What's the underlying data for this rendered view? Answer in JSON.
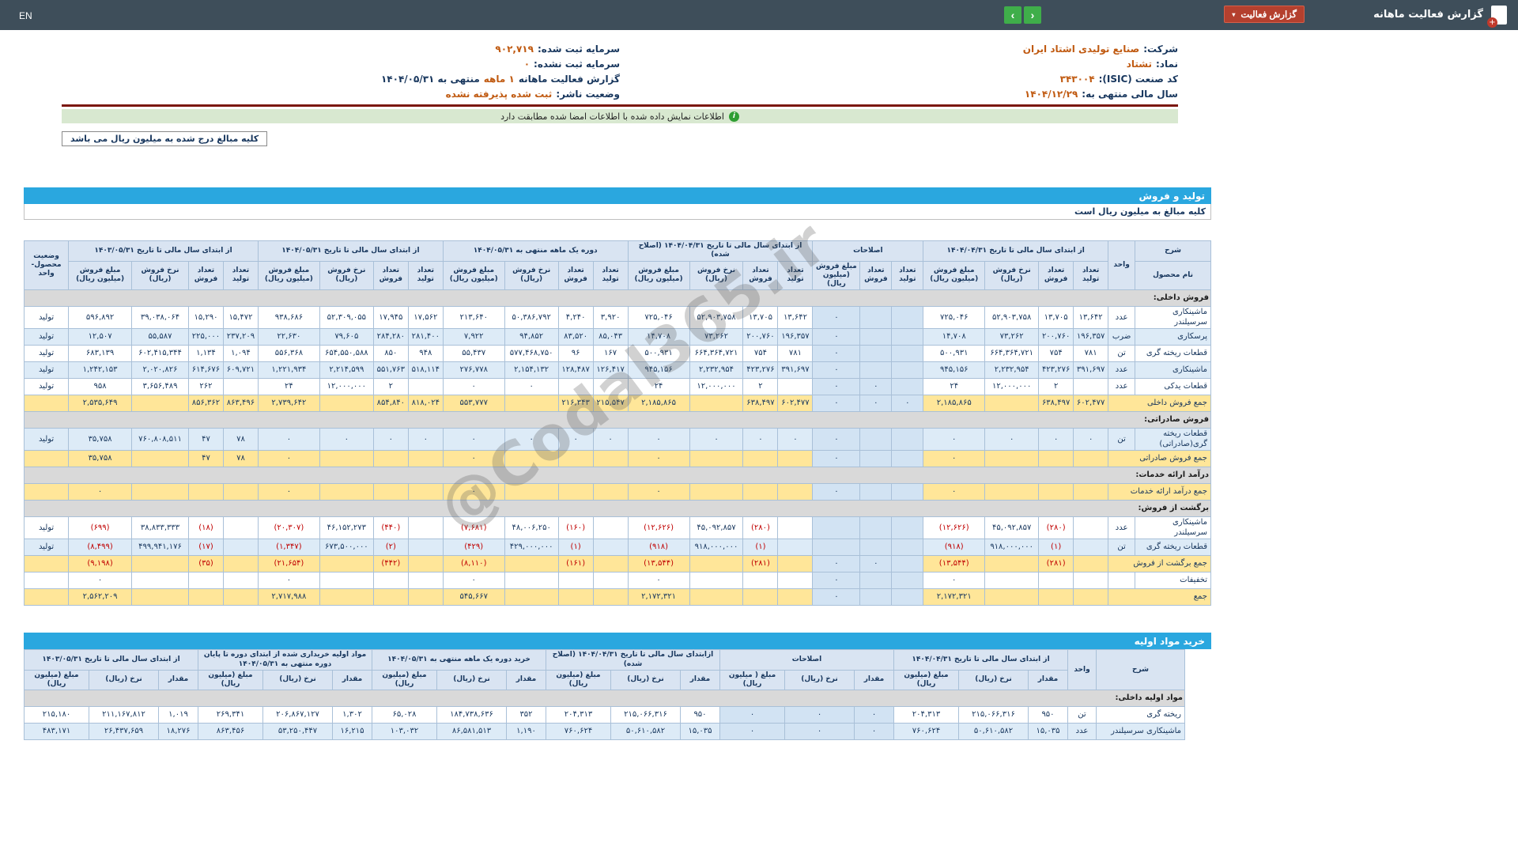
{
  "colors": {
    "topbar": "#3E4E5A",
    "accent_blue": "#2AA7DF",
    "green_button": "#3FAE4A",
    "chip_red": "#B4402E",
    "value_orange": "#C05A11",
    "negative_red": "#C00000",
    "sum_yellow": "#FFE699",
    "section_gray": "#D9D9D9",
    "signed_green": "#D8E8D0",
    "divider_red": "#7B170E"
  },
  "icons": {
    "caret_down": "▾",
    "prev_arrow": "‹",
    "next_arrow": "›",
    "info": "i",
    "plus": "+"
  },
  "watermark": "@Codal365.ir",
  "header": {
    "en_label": "EN",
    "title": "گزارش فعالیت ماهانه",
    "badge_label": "گزارش فعالیت"
  },
  "info": {
    "right_rows": [
      {
        "label": "شرکت:",
        "value": "صنایع تولیدی اشتاد ایران",
        "suffix": ""
      },
      {
        "label": "نماد:",
        "value": "تشتاد",
        "suffix": ""
      },
      {
        "label": "کد صنعت (ISIC):",
        "value": "۳۴۳۰۰۴",
        "suffix": ""
      },
      {
        "label": "سال مالی منتهی به:",
        "value": "۱۴۰۴/۱۲/۲۹",
        "suffix": ""
      }
    ],
    "left_rows": [
      {
        "label": "سرمایه ثبت شده:",
        "value": "۹۰۲,۷۱۹",
        "suffix": ""
      },
      {
        "label": "سرمایه ثبت نشده:",
        "value": "۰",
        "suffix": ""
      },
      {
        "label": "گزارش فعالیت ماهانه",
        "value": "۱ ماهه",
        "suffix": "منتهی به ۱۴۰۴/۰۵/۳۱"
      },
      {
        "label": "وضعیت ناشر:",
        "value": "ثبت شده پذیرفته نشده",
        "suffix": ""
      }
    ],
    "signed_note": "اطلاعات نمایش داده شده با اطلاعات امضا شده مطابقت دارد",
    "amounts_note": "کلیه مبالغ درج شده به میلیون ریال می باشد"
  },
  "production_sales": {
    "bar_title": "تولید و فروش",
    "note_row": "کلیه مبالغ به میلیون ریال است",
    "head": {
      "sharh": "شرح",
      "product": "نام محصول",
      "unit": "واحد",
      "status": "وضعیت محصول-واحد"
    },
    "groups": [
      {
        "label": "از ابتدای سال مالی تا تاریخ ۱۴۰۴/۰۴/۳۱",
        "cols": [
          "تعداد تولید",
          "تعداد فروش",
          "نرخ فروش (ریال)",
          "مبلغ فروش (میلیون ریال)"
        ]
      },
      {
        "label": "اصلاحات",
        "cols": [
          "تعداد تولید",
          "تعداد فروش",
          "مبلغ فروش (میلیون ریال)"
        ]
      },
      {
        "label": "از ابتدای سال مالی تا تاریخ ۱۴۰۴/۰۴/۳۱ (اصلاح شده)",
        "cols": [
          "تعداد تولید",
          "تعداد فروش",
          "نرخ فروش (ریال)",
          "مبلغ فروش (میلیون ریال)"
        ]
      },
      {
        "label": "دوره یک ماهه منتهی به ۱۴۰۴/۰۵/۳۱",
        "cols": [
          "تعداد تولید",
          "تعداد فروش",
          "نرخ فروش (ریال)",
          "مبلغ فروش (میلیون ریال)"
        ]
      },
      {
        "label": "از ابتدای سال مالی تا تاریخ ۱۴۰۴/۰۵/۳۱",
        "cols": [
          "تعداد تولید",
          "تعداد فروش",
          "نرخ فروش (ریال)",
          "مبلغ فروش (میلیون ریال)"
        ]
      },
      {
        "label": "از ابتدای سال مالی تا تاریخ ۱۴۰۳/۰۵/۳۱",
        "cols": [
          "تعداد تولید",
          "تعداد فروش",
          "نرخ فروش (ریال)",
          "مبلغ فروش (میلیون ریال)"
        ]
      }
    ],
    "rows": [
      {
        "type": "section",
        "label": "فروش داخلی:"
      },
      {
        "type": "data",
        "name": "ماشینکاری سرسیلندر",
        "unit": "عدد",
        "status": "تولید",
        "cells": [
          "۱۳,۶۴۲",
          "۱۳,۷۰۵",
          "۵۲,۹۰۳,۷۵۸",
          "۷۲۵,۰۴۶",
          "",
          "",
          "۰",
          "۱۳,۶۴۲",
          "۱۳,۷۰۵",
          "۵۲,۹۰۳,۷۵۸",
          "۷۲۵,۰۴۶",
          "۳,۹۲۰",
          "۴,۲۴۰",
          "۵۰,۳۸۶,۷۹۲",
          "۲۱۳,۶۴۰",
          "۱۷,۵۶۲",
          "۱۷,۹۴۵",
          "۵۲,۳۰۹,۰۵۵",
          "۹۳۸,۶۸۶",
          "۱۵,۴۷۲",
          "۱۵,۲۹۰",
          "۳۹,۰۳۸,۰۶۴",
          "۵۹۶,۸۹۲"
        ]
      },
      {
        "type": "data",
        "name": "پرسکاری",
        "unit": "ضرب",
        "status": "تولید",
        "cells": [
          "۱۹۶,۳۵۷",
          "۲۰۰,۷۶۰",
          "۷۳,۲۶۲",
          "۱۴,۷۰۸",
          "",
          "",
          "۰",
          "۱۹۶,۳۵۷",
          "۲۰۰,۷۶۰",
          "۷۳,۲۶۲",
          "۱۴,۷۰۸",
          "۸۵,۰۴۳",
          "۸۳,۵۲۰",
          "۹۴,۸۵۲",
          "۷,۹۲۲",
          "۲۸۱,۴۰۰",
          "۲۸۴,۲۸۰",
          "۷۹,۶۰۵",
          "۲۲,۶۳۰",
          "۲۳۷,۲۰۹",
          "۲۲۵,۰۰۰",
          "۵۵,۵۸۷",
          "۱۲,۵۰۷"
        ]
      },
      {
        "type": "data",
        "name": "قطعات ریخته گری",
        "unit": "تن",
        "status": "تولید",
        "cells": [
          "۷۸۱",
          "۷۵۴",
          "۶۶۴,۳۶۴,۷۲۱",
          "۵۰۰,۹۳۱",
          "",
          "",
          "۰",
          "۷۸۱",
          "۷۵۴",
          "۶۶۴,۳۶۴,۷۲۱",
          "۵۰۰,۹۳۱",
          "۱۶۷",
          "۹۶",
          "۵۷۷,۴۶۸,۷۵۰",
          "۵۵,۴۳۷",
          "۹۴۸",
          "۸۵۰",
          "۶۵۴,۵۵۰,۵۸۸",
          "۵۵۶,۳۶۸",
          "۱,۰۹۴",
          "۱,۱۳۴",
          "۶۰۲,۴۱۵,۳۴۴",
          "۶۸۳,۱۳۹"
        ]
      },
      {
        "type": "data",
        "name": "ماشینکاری",
        "unit": "عدد",
        "status": "تولید",
        "cells": [
          "۳۹۱,۶۹۷",
          "۴۲۳,۲۷۶",
          "۲,۲۳۲,۹۵۴",
          "۹۴۵,۱۵۶",
          "",
          "",
          "۰",
          "۳۹۱,۶۹۷",
          "۴۲۳,۲۷۶",
          "۲,۲۳۲,۹۵۴",
          "۹۴۵,۱۵۶",
          "۱۲۶,۴۱۷",
          "۱۲۸,۴۸۷",
          "۲,۱۵۴,۱۳۲",
          "۲۷۶,۷۷۸",
          "۵۱۸,۱۱۴",
          "۵۵۱,۷۶۳",
          "۲,۲۱۴,۵۹۹",
          "۱,۲۲۱,۹۳۴",
          "۶۰۹,۷۲۱",
          "۶۱۴,۶۷۶",
          "۲,۰۲۰,۸۲۶",
          "۱,۲۴۲,۱۵۳"
        ]
      },
      {
        "type": "data",
        "name": "قطعات یدکی",
        "unit": "عدد",
        "status": "تولید",
        "cells": [
          "",
          "۲",
          "۱۲,۰۰۰,۰۰۰",
          "۲۴",
          "",
          "۰",
          "۰",
          "",
          "۲",
          "۱۲,۰۰۰,۰۰۰",
          "۲۴",
          "",
          "",
          "۰",
          "۰",
          "",
          "۲",
          "۱۲,۰۰۰,۰۰۰",
          "۲۴",
          "",
          "۲۶۲",
          "۳,۶۵۶,۴۸۹",
          "۹۵۸"
        ]
      },
      {
        "type": "sum",
        "name": "جمع فروش داخلی",
        "status": "",
        "cells": [
          "۶۰۲,۴۷۷",
          "۶۳۸,۴۹۷",
          "",
          "۲,۱۸۵,۸۶۵",
          "۰",
          "۰",
          "۰",
          "۶۰۲,۴۷۷",
          "۶۳۸,۴۹۷",
          "",
          "۲,۱۸۵,۸۶۵",
          "۲۱۵,۵۴۷",
          "۲۱۶,۳۴۳",
          "",
          "۵۵۳,۷۷۷",
          "۸۱۸,۰۲۴",
          "۸۵۴,۸۴۰",
          "",
          "۲,۷۳۹,۶۴۲",
          "۸۶۳,۴۹۶",
          "۸۵۶,۳۶۲",
          "",
          "۲,۵۳۵,۶۴۹"
        ]
      },
      {
        "type": "section",
        "label": "فروش صادراتی:"
      },
      {
        "type": "data",
        "name": "قطعات ریخته گری(صادراتی)",
        "unit": "تن",
        "status": "تولید",
        "cells": [
          "۰",
          "۰",
          "۰",
          "۰",
          "",
          "",
          "۰",
          "۰",
          "۰",
          "۰",
          "۰",
          "۰",
          "۰",
          "۰",
          "۰",
          "۰",
          "۰",
          "۰",
          "۰",
          "۷۸",
          "۴۷",
          "۷۶۰,۸۰۸,۵۱۱",
          "۳۵,۷۵۸"
        ]
      },
      {
        "type": "sum",
        "name": "جمع فروش صادراتی",
        "status": "",
        "cells": [
          "",
          "",
          "",
          "۰",
          "",
          "",
          "۰",
          "",
          "",
          "",
          "۰",
          "",
          "",
          "",
          "۰",
          "",
          "",
          "",
          "۰",
          "۷۸",
          "۴۷",
          "",
          "۳۵,۷۵۸"
        ]
      },
      {
        "type": "section",
        "label": "درآمد ارائه خدمات:"
      },
      {
        "type": "sum",
        "name": "جمع درآمد ارائه خدمات",
        "status": "",
        "cells": [
          "",
          "",
          "",
          "۰",
          "",
          "",
          "۰",
          "",
          "",
          "",
          "۰",
          "",
          "",
          "",
          "۰",
          "",
          "",
          "",
          "۰",
          "",
          "",
          "",
          "۰"
        ]
      },
      {
        "type": "section",
        "label": "برگشت از فروش:"
      },
      {
        "type": "data",
        "name": "ماشینکاری سرسیلندر",
        "unit": "عدد",
        "status": "تولید",
        "cells": [
          "",
          "(۲۸۰)",
          "۴۵,۰۹۲,۸۵۷",
          "(۱۲,۶۲۶)",
          "",
          "",
          "",
          "",
          "(۲۸۰)",
          "۴۵,۰۹۲,۸۵۷",
          "(۱۲,۶۲۶)",
          "",
          "(۱۶۰)",
          "۴۸,۰۰۶,۲۵۰",
          "(۷,۶۸۱)",
          "",
          "(۴۴۰)",
          "۴۶,۱۵۲,۲۷۳",
          "(۲۰,۳۰۷)",
          "",
          "(۱۸)",
          "۳۸,۸۳۳,۳۳۳",
          "(۶۹۹)"
        ]
      },
      {
        "type": "data",
        "name": "قطعات ریخته گری",
        "unit": "تن",
        "status": "تولید",
        "cells": [
          "",
          "(۱)",
          "۹۱۸,۰۰۰,۰۰۰",
          "(۹۱۸)",
          "",
          "",
          "",
          "",
          "(۱)",
          "۹۱۸,۰۰۰,۰۰۰",
          "(۹۱۸)",
          "",
          "(۱)",
          "۴۲۹,۰۰۰,۰۰۰",
          "(۴۲۹)",
          "",
          "(۲)",
          "۶۷۳,۵۰۰,۰۰۰",
          "(۱,۳۴۷)",
          "",
          "(۱۷)",
          "۴۹۹,۹۴۱,۱۷۶",
          "(۸,۴۹۹)"
        ]
      },
      {
        "type": "sum",
        "name": "جمع برگشت از فروش",
        "status": "",
        "cells": [
          "",
          "(۲۸۱)",
          "",
          "(۱۳,۵۴۴)",
          "",
          "۰",
          "۰",
          "",
          "(۲۸۱)",
          "",
          "(۱۳,۵۴۴)",
          "",
          "(۱۶۱)",
          "",
          "(۸,۱۱۰)",
          "",
          "(۴۴۲)",
          "",
          "(۲۱,۶۵۴)",
          "",
          "(۳۵)",
          "",
          "(۹,۱۹۸)"
        ]
      },
      {
        "type": "data",
        "name": "تخفیفات",
        "unit": "",
        "status": "",
        "cells": [
          "",
          "",
          "",
          "۰",
          "",
          "",
          "۰",
          "",
          "",
          "",
          "۰",
          "",
          "",
          "",
          "۰",
          "",
          "",
          "",
          "۰",
          "",
          "",
          "",
          "۰"
        ]
      },
      {
        "type": "sum",
        "name": "جمع",
        "status": "",
        "cells": [
          "",
          "",
          "",
          "۲,۱۷۲,۳۲۱",
          "",
          "",
          "۰",
          "",
          "",
          "",
          "۲,۱۷۲,۳۲۱",
          "",
          "",
          "",
          "۵۴۵,۶۶۷",
          "",
          "",
          "",
          "۲,۷۱۷,۹۸۸",
          "",
          "",
          "",
          "۲,۵۶۲,۲۰۹"
        ]
      }
    ]
  },
  "raw_materials": {
    "bar_title": "خرید مواد اولیه",
    "head": {
      "sharh": "شرح",
      "unit": "واحد"
    },
    "groups": [
      {
        "label": "از ابتدای سال مالی تا تاریخ ۱۴۰۴/۰۴/۳۱",
        "cols": [
          "مقدار",
          "نرخ (ریال)",
          "مبلغ (میلیون ریال)"
        ]
      },
      {
        "label": "اصلاحات",
        "cols": [
          "مقدار",
          "نرخ (ریال)",
          "مبلغ ( میلیون ریال)"
        ]
      },
      {
        "label": "ازابتدای سال مالی تا تاریخ ۱۴۰۴/۰۴/۳۱ (اصلاح شده)",
        "cols": [
          "مقدار",
          "نرخ (ریال)",
          "مبلغ (میلیون ریال)"
        ]
      },
      {
        "label": "خرید دوره یک ماهه منتهی به ۱۴۰۴/۰۵/۳۱",
        "cols": [
          "مقدار",
          "نرخ (ریال)",
          "مبلغ (میلیون ریال)"
        ]
      },
      {
        "label": "مواد اولیه خریداری شده از ابتدای دوره تا پایان دوره منتهی به ۱۴۰۴/۰۵/۳۱",
        "cols": [
          "مقدار",
          "نرخ (ریال)",
          "مبلغ (میلیون ریال)"
        ]
      },
      {
        "label": "از ابتدای سال مالی تا تاریخ ۱۴۰۳/۰۵/۳۱",
        "cols": [
          "مقدار",
          "نرخ (ریال)",
          "مبلغ (میلیون ریال)"
        ]
      }
    ],
    "rows": [
      {
        "type": "section",
        "label": "مواد اولیه داخلی:"
      },
      {
        "type": "data",
        "name": "ریخته گری",
        "unit": "تن",
        "cells": [
          "۹۵۰",
          "۲۱۵,۰۶۶,۳۱۶",
          "۲۰۴,۳۱۳",
          "۰",
          "۰",
          "۰",
          "۹۵۰",
          "۲۱۵,۰۶۶,۳۱۶",
          "۲۰۴,۳۱۳",
          "۳۵۲",
          "۱۸۴,۷۳۸,۶۳۶",
          "۶۵,۰۲۸",
          "۱,۳۰۲",
          "۲۰۶,۸۶۷,۱۲۷",
          "۲۶۹,۳۴۱",
          "۱,۰۱۹",
          "۲۱۱,۱۶۷,۸۱۲",
          "۲۱۵,۱۸۰"
        ]
      },
      {
        "type": "data",
        "name": "ماشینکاری سرسیلندر",
        "unit": "عدد",
        "cells": [
          "۱۵,۰۳۵",
          "۵۰,۶۱۰,۵۸۲",
          "۷۶۰,۶۲۴",
          "۰",
          "۰",
          "۰",
          "۱۵,۰۳۵",
          "۵۰,۶۱۰,۵۸۲",
          "۷۶۰,۶۲۴",
          "۱,۱۹۰",
          "۸۶,۵۸۱,۵۱۳",
          "۱۰۳,۰۳۲",
          "۱۶,۲۱۵",
          "۵۳,۲۵۰,۴۴۷",
          "۸۶۳,۴۵۶",
          "۱۸,۲۷۶",
          "۲۶,۴۳۷,۶۵۹",
          "۴۸۳,۱۷۱"
        ]
      }
    ]
  }
}
